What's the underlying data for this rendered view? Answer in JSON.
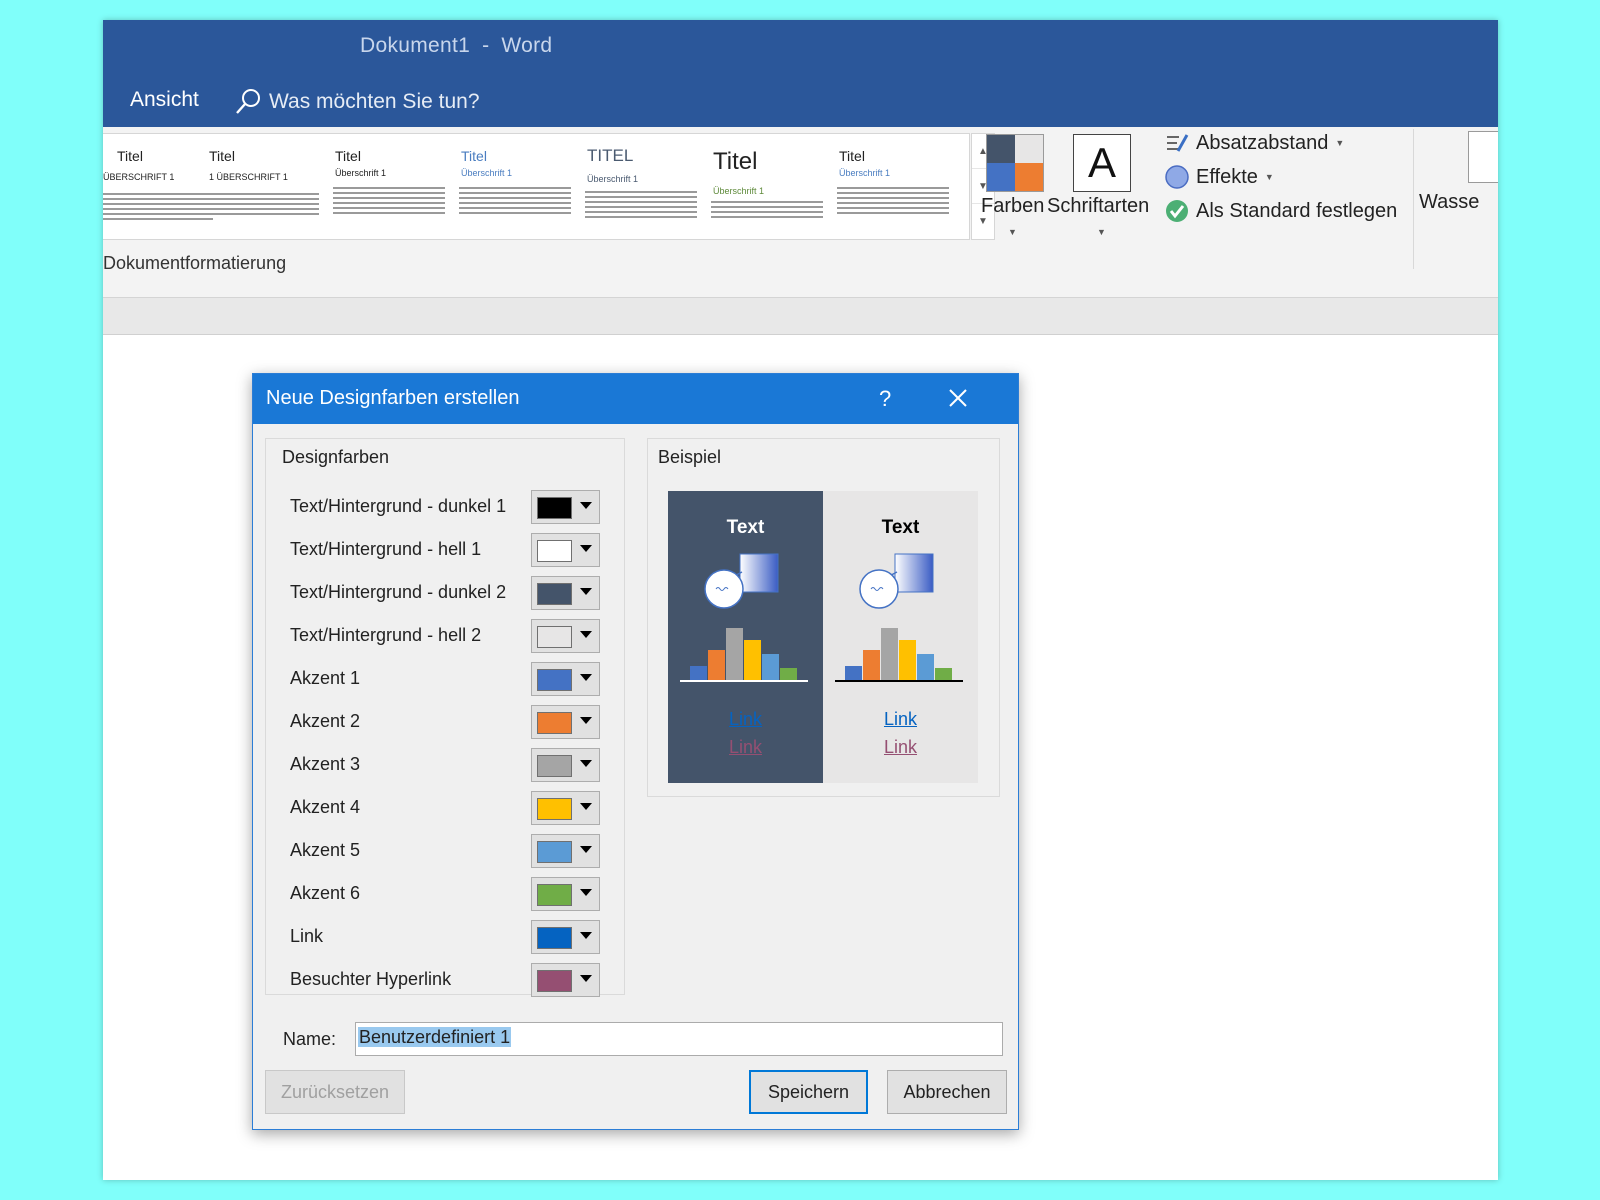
{
  "window": {
    "doc_name": "Dokument1",
    "separator": "-",
    "app_name": "Word"
  },
  "ribbon": {
    "tab_ansicht": "Ansicht",
    "tell_me": "Was möchten Sie tun?",
    "gallery_label": "Dokumentformatierung",
    "gallery_thumbs": [
      {
        "title": "Titel",
        "heading": "ÜBERSCHRIFT 1"
      },
      {
        "title": "Titel",
        "heading": "1 ÜBERSCHRIFT 1"
      },
      {
        "title": "Titel",
        "heading": "Überschrift 1"
      },
      {
        "title": "Titel",
        "heading": "Überschrift 1"
      },
      {
        "title": "TITEL",
        "heading": "Überschrift 1"
      },
      {
        "title": "Titel",
        "heading": "Überschrift 1"
      },
      {
        "title": "Titel",
        "heading": "Überschrift 1"
      }
    ],
    "farben": "Farben",
    "schriftarten": "Schriftarten",
    "schriftarten_glyph": "A",
    "absatzabstand": "Absatzabstand",
    "effekte": "Effekte",
    "als_standard": "Als Standard festlegen",
    "wasserzeichen": "Wasse"
  },
  "dialog": {
    "title": "Neue Designfarben erstellen",
    "help": "?",
    "group_design": "Designfarben",
    "group_beispiel": "Beispiel",
    "colors": [
      {
        "label": "Text/Hintergrund - dunkel 1",
        "color": "#000000"
      },
      {
        "label": "Text/Hintergrund - hell 1",
        "color": "#FFFFFF"
      },
      {
        "label": "Text/Hintergrund - dunkel 2",
        "color": "#44546A"
      },
      {
        "label": "Text/Hintergrund - hell 2",
        "color": "#E7E6E6"
      },
      {
        "label": "Akzent 1",
        "color": "#4472C4"
      },
      {
        "label": "Akzent 2",
        "color": "#ED7D31"
      },
      {
        "label": "Akzent 3",
        "color": "#A5A5A5"
      },
      {
        "label": "Akzent 4",
        "color": "#FFC000"
      },
      {
        "label": "Akzent 5",
        "color": "#5B9BD5"
      },
      {
        "label": "Akzent 6",
        "color": "#70AD47"
      },
      {
        "label": "Link",
        "color": "#0563C1"
      },
      {
        "label": "Besuchter Hyperlink",
        "color": "#954F72"
      }
    ],
    "preview": {
      "text": "Text",
      "link": "Link",
      "visited_link": "Link"
    },
    "name_label": "Name:",
    "name_value": "Benutzerdefiniert 1",
    "btn_reset": "Zurücksetzen",
    "btn_save": "Speichern",
    "btn_cancel": "Abbrechen"
  }
}
